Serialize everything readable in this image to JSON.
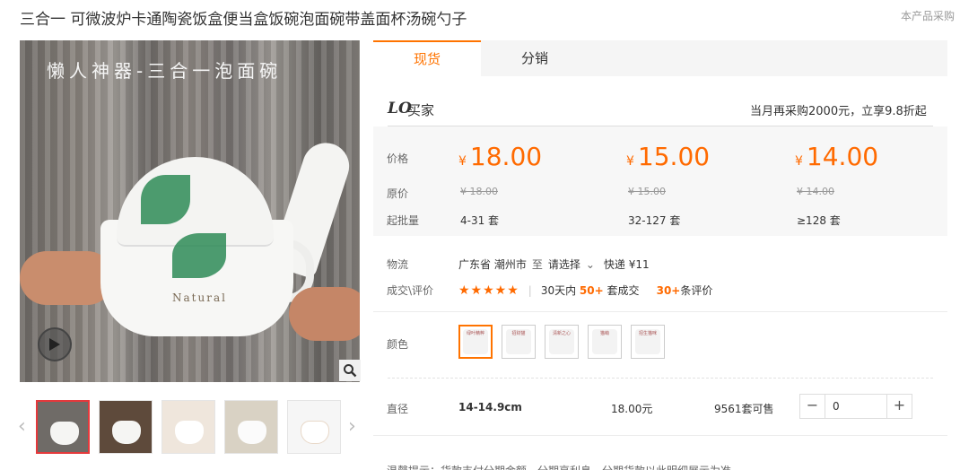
{
  "product": {
    "title": "三合一 可微波炉卡通陶瓷饭盒便当盒饭碗泡面碗带盖面杯汤碗勺子",
    "notice": "本产品采购"
  },
  "gallery": {
    "caption": "懒人神器-三合一泡面碗",
    "brand_mark": "Natural",
    "thumbnail_count": 5
  },
  "tabs": [
    {
      "label": "现货",
      "active": true
    },
    {
      "label": "分销",
      "active": false
    }
  ],
  "seller": {
    "logo": "LO",
    "name": "买家",
    "promo": "当月再采购2000元，立享9.8折起"
  },
  "pricing": {
    "price_label": "价格",
    "orig_label": "原价",
    "moq_label": "起批量",
    "currency": "¥",
    "tiers": [
      {
        "price": "18.00",
        "orig": "¥ 18.00",
        "moq": "4-31 套"
      },
      {
        "price": "15.00",
        "orig": "¥ 15.00",
        "moq": "32-127 套"
      },
      {
        "price": "14.00",
        "orig": "¥ 14.00",
        "moq": "≥128 套"
      }
    ]
  },
  "logistics": {
    "label": "物流",
    "from": "广东省 潮州市",
    "to_word": "至",
    "select": "请选择",
    "express": "快递 ¥11"
  },
  "reviews": {
    "label": "成交\\评价",
    "stars": "★★★★★",
    "sales_prefix": "30天内",
    "sales_count": "50+",
    "sales_suffix": "套成交",
    "review_count": "30+",
    "review_suffix": "条评价"
  },
  "color": {
    "label": "颜色",
    "swatches": [
      "绿叶精粹",
      "招财猫",
      "清新之心",
      "猫萌",
      "招生猫咪"
    ]
  },
  "spec": {
    "label": "直径",
    "name": "14-14.9cm",
    "price": "18.00元",
    "stock": "9561套可售",
    "quantity": "0"
  },
  "tip": "温馨提示：货款支付分期金额，分期享利息，分期货款以此明细展示为准"
}
